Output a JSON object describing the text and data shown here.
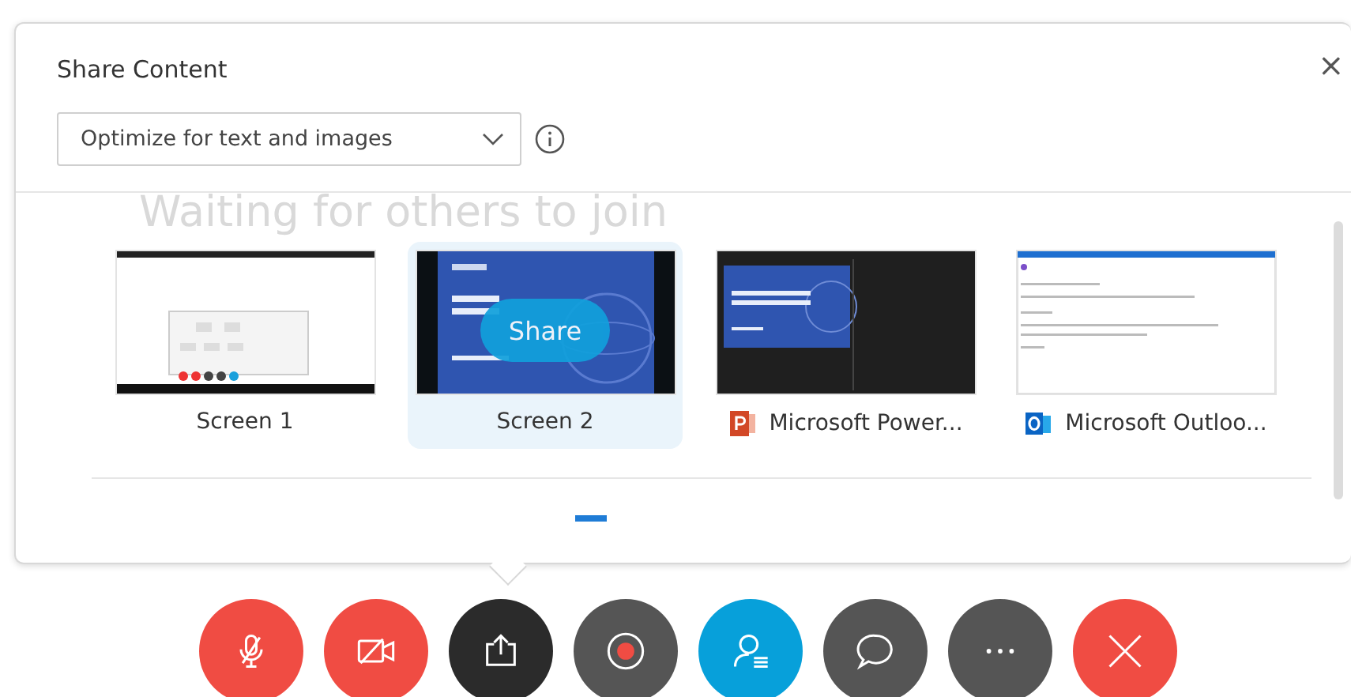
{
  "dialog": {
    "title": "Share Content",
    "close_label": "×",
    "optimize_dropdown": {
      "value": "Optimize for text and images"
    },
    "background_text": "Waiting for others to join",
    "share_button": "Share",
    "share_targets": [
      {
        "label": "Screen 1",
        "kind": "desktop",
        "selected": false
      },
      {
        "label": "Screen 2",
        "kind": "slide",
        "selected": true
      },
      {
        "label": "Microsoft Power...",
        "kind": "powerpoint",
        "selected": false
      },
      {
        "label": "Microsoft Outloo...",
        "kind": "outlook",
        "selected": false
      }
    ]
  },
  "toolbar": [
    {
      "kind": "mic-muted",
      "color": "#f04c43"
    },
    {
      "kind": "camera-off",
      "color": "#f04c43"
    },
    {
      "kind": "share",
      "color": "#2b2b2b"
    },
    {
      "kind": "record",
      "color": "#555555"
    },
    {
      "kind": "participants",
      "color": "#07a0da"
    },
    {
      "kind": "chat",
      "color": "#555555"
    },
    {
      "kind": "more",
      "color": "#555555"
    },
    {
      "kind": "leave",
      "color": "#f04c43"
    }
  ]
}
